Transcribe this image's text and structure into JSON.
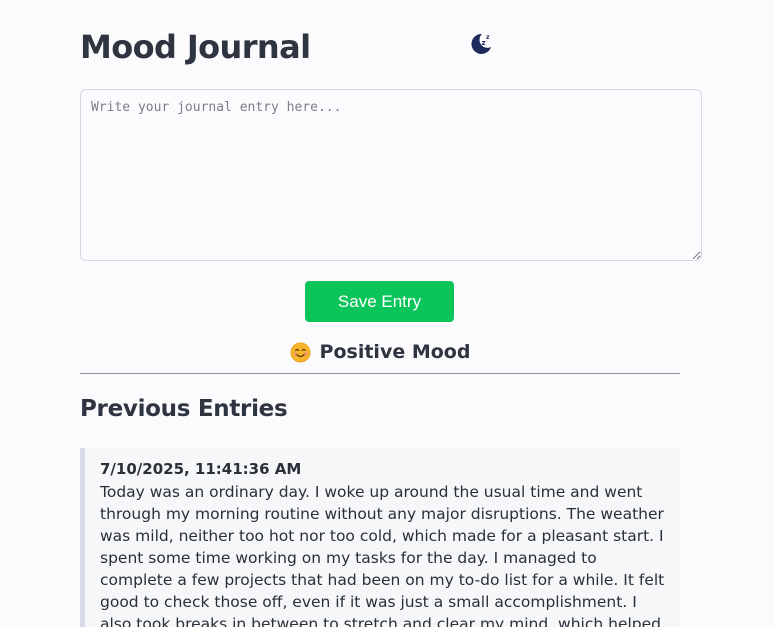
{
  "header": {
    "title": "Mood Journal",
    "theme_toggle_icon": "moon-sleep-icon",
    "theme_toggle_color": "#1f2a5c"
  },
  "editor": {
    "placeholder": "Write your journal entry here...",
    "value": ""
  },
  "actions": {
    "save_label": "Save Entry",
    "save_color": "#0bc45a"
  },
  "mood": {
    "icon": "smiling-face-icon",
    "label": "Positive Mood"
  },
  "history": {
    "title": "Previous Entries",
    "entries": [
      {
        "date": "7/10/2025, 11:41:36 AM",
        "text": "Today was an ordinary day. I woke up around the usual time and went through my morning routine without any major disruptions. The weather was mild, neither too hot nor too cold, which made for a pleasant start. I spent some time working on my tasks for the day. I managed to complete a few projects that had been on my to-do list for a while. It felt good to check those off, even if it was just a small accomplishment. I also took breaks in between to stretch and clear my mind, which helped maintain my focus."
      }
    ]
  }
}
